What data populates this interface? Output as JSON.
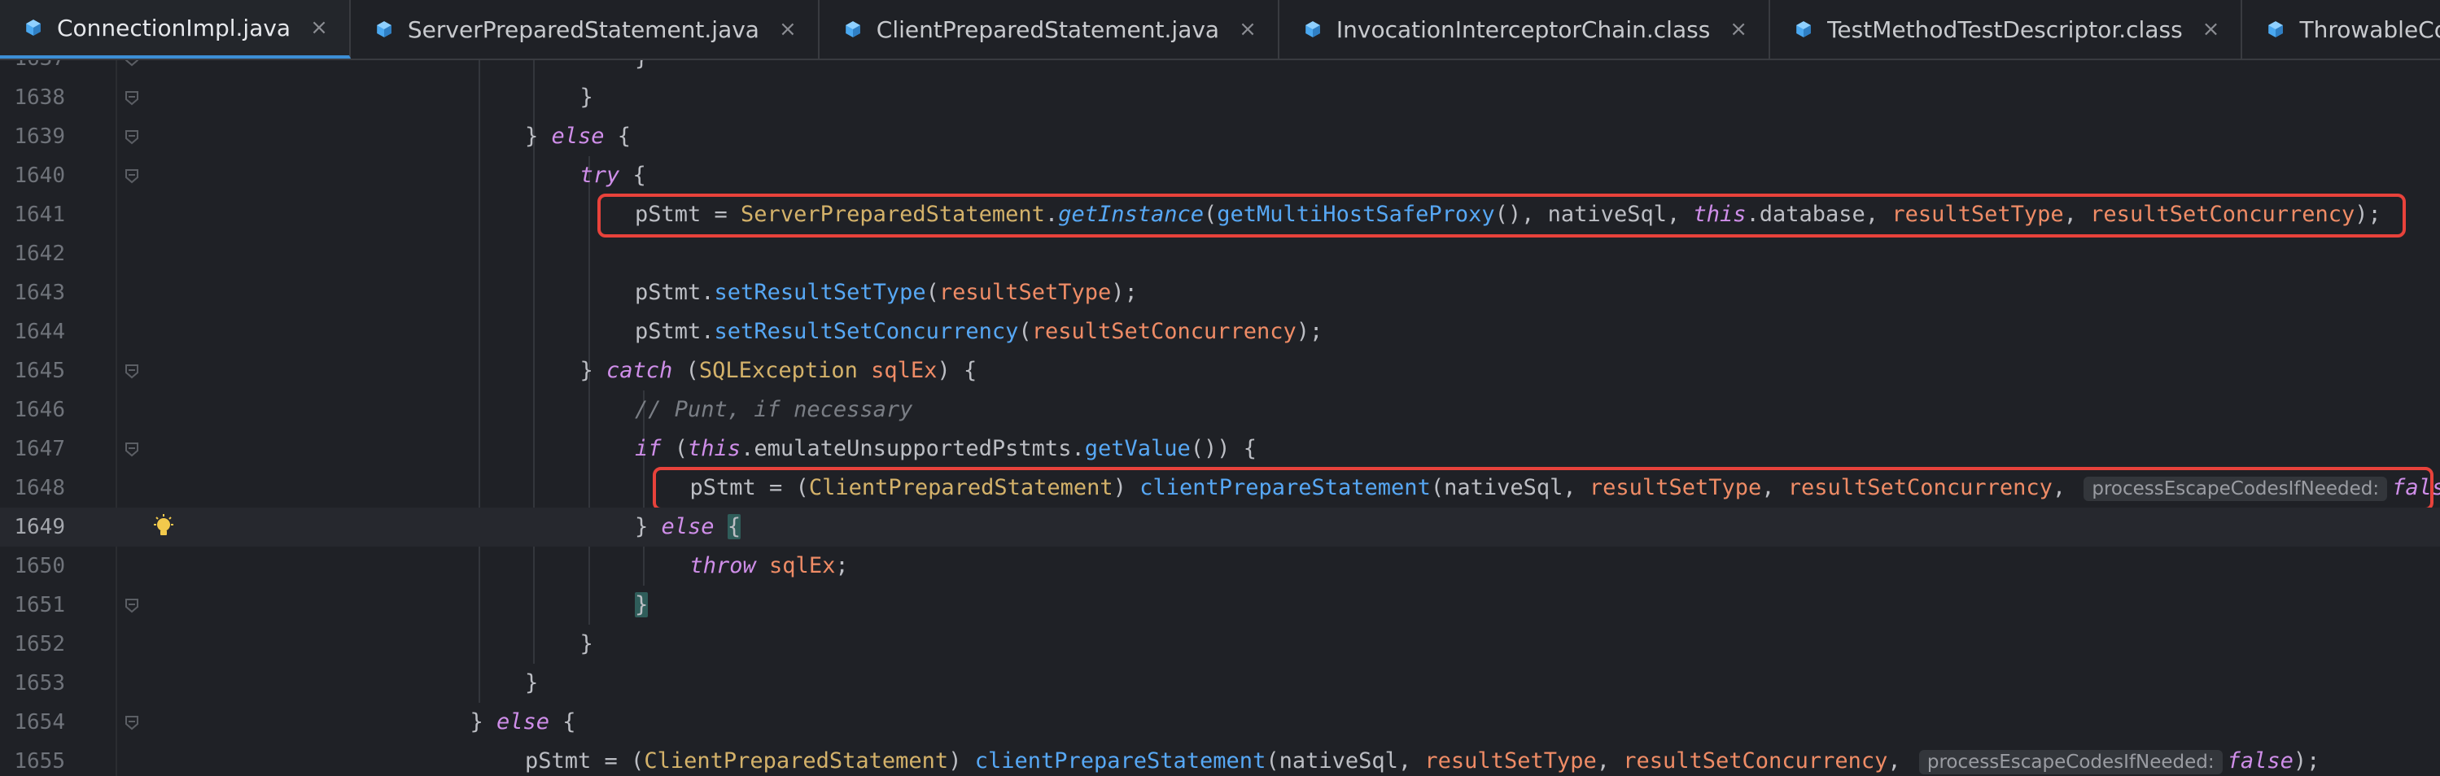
{
  "tabs": [
    {
      "label": "ConnectionImpl.java",
      "active": true
    },
    {
      "label": "ServerPreparedStatement.java",
      "active": false
    },
    {
      "label": "ClientPreparedStatement.java",
      "active": false
    },
    {
      "label": "InvocationInterceptorChain.class",
      "active": false
    },
    {
      "label": "TestMethodTestDescriptor.class",
      "active": false
    },
    {
      "label": "ThrowableCollector.class",
      "active": false
    }
  ],
  "close_glyph": "×",
  "colors": {
    "accent": "#3d8fd6",
    "highlight_box": "#e8423b",
    "background": "#1f2126"
  },
  "lines": [
    {
      "num": "1637",
      "indent": 8,
      "tokens": [
        [
          "txt",
          "}"
        ]
      ]
    },
    {
      "num": "1638",
      "indent": 7,
      "tokens": [
        [
          "txt",
          "}"
        ]
      ]
    },
    {
      "num": "1639",
      "indent": 6,
      "tokens": [
        [
          "txt",
          "} "
        ],
        [
          "kw",
          "else"
        ],
        [
          "txt",
          " {"
        ]
      ]
    },
    {
      "num": "1640",
      "indent": 7,
      "tokens": [
        [
          "kw",
          "try"
        ],
        [
          "txt",
          " {"
        ]
      ]
    },
    {
      "num": "1641",
      "indent": 8,
      "tokens": [
        [
          "txt",
          "pStmt = "
        ],
        [
          "cls",
          "ServerPreparedStatement"
        ],
        [
          "txt",
          "."
        ],
        [
          "mthi",
          "getInstance"
        ],
        [
          "txt",
          "("
        ],
        [
          "mth",
          "getMultiHostSafeProxy"
        ],
        [
          "txt",
          "(), nativeSql, "
        ],
        [
          "kw",
          "this"
        ],
        [
          "txt",
          ".database, "
        ],
        [
          "par",
          "resultSetType"
        ],
        [
          "txt",
          ", "
        ],
        [
          "par",
          "resultSetConcurrency"
        ],
        [
          "txt",
          ");"
        ]
      ]
    },
    {
      "num": "1642",
      "indent": 8,
      "tokens": []
    },
    {
      "num": "1643",
      "indent": 8,
      "tokens": [
        [
          "txt",
          "pStmt."
        ],
        [
          "mth",
          "setResultSetType"
        ],
        [
          "txt",
          "("
        ],
        [
          "par",
          "resultSetType"
        ],
        [
          "txt",
          ");"
        ]
      ]
    },
    {
      "num": "1644",
      "indent": 8,
      "tokens": [
        [
          "txt",
          "pStmt."
        ],
        [
          "mth",
          "setResultSetConcurrency"
        ],
        [
          "txt",
          "("
        ],
        [
          "par",
          "resultSetConcurrency"
        ],
        [
          "txt",
          ");"
        ]
      ]
    },
    {
      "num": "1645",
      "indent": 7,
      "tokens": [
        [
          "txt",
          "} "
        ],
        [
          "kw",
          "catch"
        ],
        [
          "txt",
          " ("
        ],
        [
          "cls",
          "SQLException"
        ],
        [
          "txt",
          " "
        ],
        [
          "par",
          "sqlEx"
        ],
        [
          "txt",
          ") {"
        ]
      ]
    },
    {
      "num": "1646",
      "indent": 8,
      "tokens": [
        [
          "cmt",
          "// Punt, if necessary"
        ]
      ]
    },
    {
      "num": "1647",
      "indent": 8,
      "tokens": [
        [
          "kw",
          "if"
        ],
        [
          "txt",
          " ("
        ],
        [
          "kw",
          "this"
        ],
        [
          "txt",
          ".emulateUnsupportedPstmts."
        ],
        [
          "mth",
          "getValue"
        ],
        [
          "txt",
          "()) {"
        ]
      ]
    },
    {
      "num": "1648",
      "indent": 9,
      "tokens": [
        [
          "txt",
          "pStmt = ("
        ],
        [
          "cls",
          "ClientPreparedStatement"
        ],
        [
          "txt",
          ") "
        ],
        [
          "mth",
          "clientPrepareStatement"
        ],
        [
          "txt",
          "(nativeSql, "
        ],
        [
          "par",
          "resultSetType"
        ],
        [
          "txt",
          ", "
        ],
        [
          "par",
          "resultSetConcurrency"
        ],
        [
          "txt",
          ", "
        ],
        [
          "hint",
          "processEscapeCodesIfNeeded:"
        ],
        [
          "kw",
          "false"
        ],
        [
          "txt",
          ");"
        ]
      ]
    },
    {
      "num": "1649",
      "indent": 8,
      "current": true,
      "tokens": [
        [
          "txt",
          "} "
        ],
        [
          "kw",
          "else"
        ],
        [
          "txt",
          " "
        ],
        [
          "bh",
          "{"
        ]
      ]
    },
    {
      "num": "1650",
      "indent": 9,
      "tokens": [
        [
          "kw",
          "throw"
        ],
        [
          "txt",
          " "
        ],
        [
          "par",
          "sqlEx"
        ],
        [
          "txt",
          ";"
        ]
      ]
    },
    {
      "num": "1651",
      "indent": 8,
      "tokens": [
        [
          "bh",
          "}"
        ]
      ]
    },
    {
      "num": "1652",
      "indent": 7,
      "tokens": [
        [
          "txt",
          "}"
        ]
      ]
    },
    {
      "num": "1653",
      "indent": 6,
      "tokens": [
        [
          "txt",
          "}"
        ]
      ]
    },
    {
      "num": "1654",
      "indent": 5,
      "tokens": [
        [
          "txt",
          "} "
        ],
        [
          "kw",
          "else"
        ],
        [
          "txt",
          " {"
        ]
      ]
    },
    {
      "num": "1655",
      "indent": 6,
      "tokens": [
        [
          "txt",
          "pStmt = ("
        ],
        [
          "cls",
          "ClientPreparedStatement"
        ],
        [
          "txt",
          ") "
        ],
        [
          "mth",
          "clientPrepareStatement"
        ],
        [
          "txt",
          "(nativeSql, "
        ],
        [
          "par",
          "resultSetType"
        ],
        [
          "txt",
          ", "
        ],
        [
          "par",
          "resultSetConcurrency"
        ],
        [
          "txt",
          ", "
        ],
        [
          "hint",
          "processEscapeCodesIfNeeded:"
        ],
        [
          "kw",
          "false"
        ],
        [
          "txt",
          ");"
        ]
      ]
    }
  ]
}
